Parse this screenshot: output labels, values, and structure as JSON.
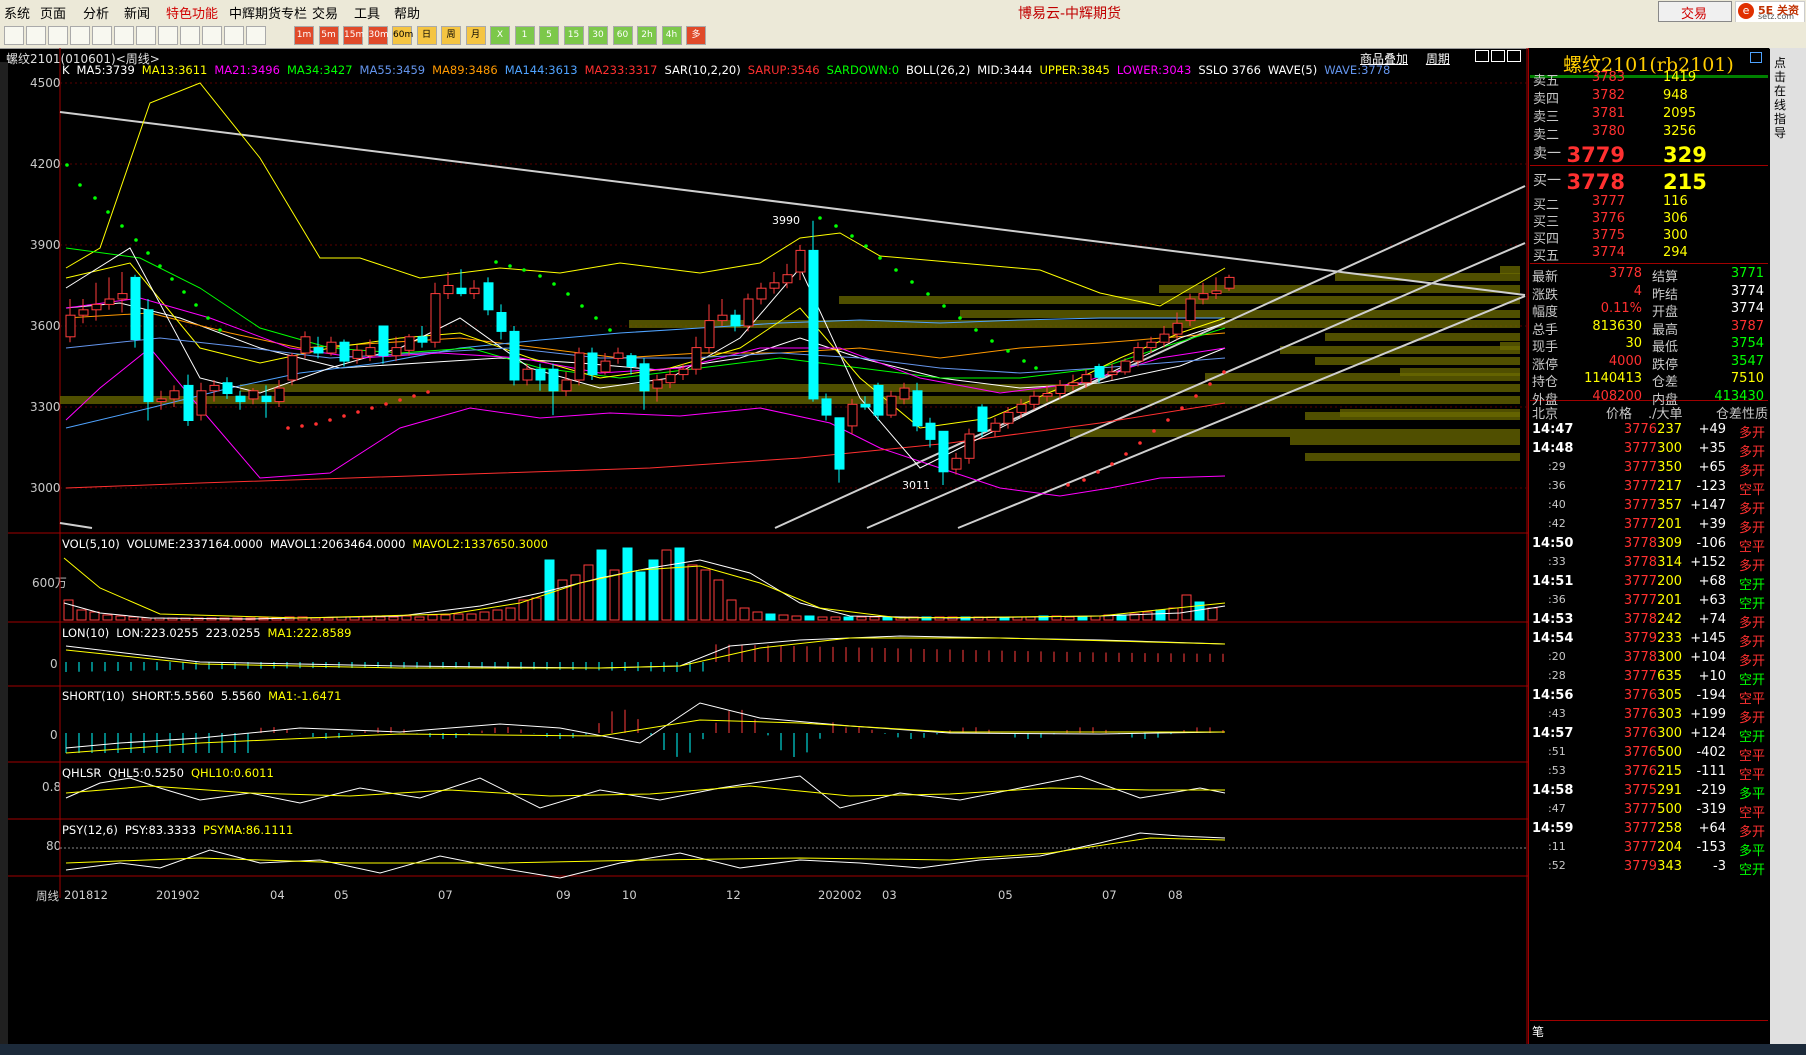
{
  "menu": {
    "items": [
      "系统",
      "页面",
      "分析",
      "新闻",
      "特色功能",
      "中辉期货专栏",
      "交易",
      "工具",
      "帮助"
    ],
    "highlight_index": 4,
    "app_title": "博易云-中辉期货",
    "trade_button": "交易",
    "logo_text": "5E 关资",
    "logo_sub": "setz.com"
  },
  "toolbar": {
    "buttons": [
      "1m",
      "5m",
      "15m",
      "30m",
      "60m",
      "日",
      "周",
      "月",
      "X",
      "1",
      "5",
      "15",
      "30",
      "60",
      "2h",
      "4h",
      "多"
    ]
  },
  "chart": {
    "title": "螺纹2101(010601)<周线>",
    "tabs": [
      "商品叠加",
      "周期"
    ],
    "ma_line": [
      {
        "t": "K",
        "c": "#ffffff"
      },
      {
        "t": "MA5:3739",
        "c": "#ffffff"
      },
      {
        "t": "MA13:3611",
        "c": "#ffff00"
      },
      {
        "t": "MA21:3496",
        "c": "#ff00ff"
      },
      {
        "t": "MA34:3427",
        "c": "#00ff00"
      },
      {
        "t": "MA55:3459",
        "c": "#6495ed"
      },
      {
        "t": "MA89:3486",
        "c": "#ff9900"
      },
      {
        "t": "MA144:3613",
        "c": "#4fa3ff"
      },
      {
        "t": "MA233:3317",
        "c": "#ff3030"
      },
      {
        "t": "SAR(10,2,20)",
        "c": "#ffffff"
      },
      {
        "t": "SARUP:3546",
        "c": "#ff3030"
      },
      {
        "t": "SARDOWN:0",
        "c": "#00ff00"
      },
      {
        "t": "BOLL(26,2)",
        "c": "#ffffff"
      },
      {
        "t": "MID:3444",
        "c": "#ffffff"
      },
      {
        "t": "UPPER:3845",
        "c": "#ffff00"
      },
      {
        "t": "LOWER:3043",
        "c": "#ff00ff"
      },
      {
        "t": "SSLO 3766",
        "c": "#ffffff"
      },
      {
        "t": "WAVE(5)",
        "c": "#ffffff"
      },
      {
        "t": "WAVE:3778",
        "c": "#6495ed"
      }
    ],
    "y_labels": [
      "4500",
      "4200",
      "3900",
      "3600",
      "3300",
      "3000"
    ],
    "y_values": [
      4500,
      4200,
      3900,
      3600,
      3300,
      3000
    ],
    "hi_label": "3990",
    "lo_label": "3011",
    "x_labels": [
      "周线",
      "201812",
      "201902",
      "04",
      "05",
      "07",
      "09",
      "10",
      "12",
      "202002",
      "03",
      "05",
      "07",
      "08"
    ],
    "vol_line": [
      {
        "t": "VOL(5,10)",
        "c": "#ffffff"
      },
      {
        "t": "VOLUME:2337164.0000",
        "c": "#ffffff"
      },
      {
        "t": "MAVOL1:2063464.0000",
        "c": "#ffffff"
      },
      {
        "t": "MAVOL2:1337650.3000",
        "c": "#ffff00"
      }
    ],
    "vol_label": "600万",
    "lon_line": [
      {
        "t": "LON(10)",
        "c": "#ffffff"
      },
      {
        "t": "LON:223.0255",
        "c": "#ffffff"
      },
      {
        "t": "223.0255",
        "c": "#ffffff"
      },
      {
        "t": "MA1:222.8589",
        "c": "#ffff00"
      }
    ],
    "lon_label": "0",
    "short_line": [
      {
        "t": "SHORT(10)",
        "c": "#ffffff"
      },
      {
        "t": "SHORT:5.5560",
        "c": "#ffffff"
      },
      {
        "t": "5.5560",
        "c": "#ffffff"
      },
      {
        "t": "MA1:-1.6471",
        "c": "#ffff00"
      }
    ],
    "short_label": "0",
    "qhl_line": [
      {
        "t": "QHLSR",
        "c": "#ffffff"
      },
      {
        "t": "QHL5:0.5250",
        "c": "#ffffff"
      },
      {
        "t": "QHL10:0.6011",
        "c": "#ffff00"
      }
    ],
    "qhl_label": "0.8",
    "psy_line": [
      {
        "t": "PSY(12,6)",
        "c": "#ffffff"
      },
      {
        "t": "PSY:83.3333",
        "c": "#ffffff"
      },
      {
        "t": "PSYMA:86.1111",
        "c": "#ffff00"
      }
    ],
    "psy_label": "80"
  },
  "panel": {
    "title": "螺纹2101(rb2101)",
    "asks": [
      {
        "l": "卖五",
        "p": "3783",
        "v": "1419"
      },
      {
        "l": "卖四",
        "p": "3782",
        "v": "948"
      },
      {
        "l": "卖三",
        "p": "3781",
        "v": "2095"
      },
      {
        "l": "卖二",
        "p": "3780",
        "v": "3256"
      },
      {
        "l": "卖一",
        "p": "3779",
        "v": "329"
      }
    ],
    "bids": [
      {
        "l": "买一",
        "p": "3778",
        "v": "215"
      },
      {
        "l": "买二",
        "p": "3777",
        "v": "116"
      },
      {
        "l": "买三",
        "p": "3776",
        "v": "306"
      },
      {
        "l": "买四",
        "p": "3775",
        "v": "300"
      },
      {
        "l": "买五",
        "p": "3774",
        "v": "294"
      }
    ],
    "quotes": [
      {
        "k1": "最新",
        "v1": "3778",
        "c1": "#ff3030",
        "k2": "结算",
        "v2": "3771",
        "c2": "#00ff00"
      },
      {
        "k1": "涨跌",
        "v1": "4",
        "c1": "#ff3030",
        "k2": "昨结",
        "v2": "3774",
        "c2": "#ffffff"
      },
      {
        "k1": "幅度",
        "v1": "0.11%",
        "c1": "#ff3030",
        "k2": "开盘",
        "v2": "3774",
        "c2": "#ffffff"
      },
      {
        "k1": "总手",
        "v1": "813630",
        "c1": "#ffff00",
        "k2": "最高",
        "v2": "3787",
        "c2": "#ff3030"
      },
      {
        "k1": "现手",
        "v1": "30",
        "c1": "#ffff00",
        "k2": "最低",
        "v2": "3754",
        "c2": "#00ff00"
      },
      {
        "k1": "涨停",
        "v1": "4000",
        "c1": "#ff3030",
        "k2": "跌停",
        "v2": "3547",
        "c2": "#00ff00"
      },
      {
        "k1": "持仓",
        "v1": "1140413",
        "c1": "#ffff00",
        "k2": "仓差",
        "v2": "7510",
        "c2": "#ffff00"
      },
      {
        "k1": "外盘",
        "v1": "408200",
        "c1": "#ff3030",
        "k2": "内盘",
        "v2": "413430",
        "c2": "#00ff00"
      }
    ],
    "ts_headers": [
      "北京",
      "价格",
      "./大单",
      "仓差",
      "性质"
    ],
    "ticks": [
      {
        "t": "14:47",
        "s": false,
        "p": "3776",
        "q": "237",
        "d": "+49",
        "n": "多开",
        "nc": "#ff3030"
      },
      {
        "t": "14:48",
        "s": false,
        "p": "3777",
        "q": "300",
        "d": "+35",
        "n": "多开",
        "nc": "#ff3030"
      },
      {
        "t": ":29",
        "s": true,
        "p": "3777",
        "q": "350",
        "d": "+65",
        "n": "多开",
        "nc": "#ff3030"
      },
      {
        "t": ":36",
        "s": true,
        "p": "3777",
        "q": "217",
        "d": "-123",
        "n": "空平",
        "nc": "#ff3030"
      },
      {
        "t": ":40",
        "s": true,
        "p": "3777",
        "q": "357",
        "d": "+147",
        "n": "多开",
        "nc": "#ff3030"
      },
      {
        "t": ":42",
        "s": true,
        "p": "3777",
        "q": "201",
        "d": "+39",
        "n": "多开",
        "nc": "#ff3030"
      },
      {
        "t": "14:50",
        "s": false,
        "p": "3778",
        "q": "309",
        "d": "-106",
        "n": "空平",
        "nc": "#ff3030"
      },
      {
        "t": ":33",
        "s": true,
        "p": "3778",
        "q": "314",
        "d": "+152",
        "n": "多开",
        "nc": "#ff3030"
      },
      {
        "t": "14:51",
        "s": false,
        "p": "3777",
        "q": "200",
        "d": "+68",
        "n": "空开",
        "nc": "#00ff00"
      },
      {
        "t": ":36",
        "s": true,
        "p": "3777",
        "q": "201",
        "d": "+63",
        "n": "空开",
        "nc": "#00ff00"
      },
      {
        "t": "14:53",
        "s": false,
        "p": "3778",
        "q": "242",
        "d": "+74",
        "n": "多开",
        "nc": "#ff3030"
      },
      {
        "t": "14:54",
        "s": false,
        "p": "3779",
        "q": "233",
        "d": "+145",
        "n": "多开",
        "nc": "#ff3030"
      },
      {
        "t": ":20",
        "s": true,
        "p": "3778",
        "q": "300",
        "d": "+104",
        "n": "多开",
        "nc": "#ff3030"
      },
      {
        "t": ":28",
        "s": true,
        "p": "3777",
        "q": "635",
        "d": "+10",
        "n": "空开",
        "nc": "#00ff00"
      },
      {
        "t": "14:56",
        "s": false,
        "p": "3776",
        "q": "305",
        "d": "-194",
        "n": "空平",
        "nc": "#ff3030"
      },
      {
        "t": ":43",
        "s": true,
        "p": "3776",
        "q": "303",
        "d": "+199",
        "n": "多开",
        "nc": "#ff3030"
      },
      {
        "t": "14:57",
        "s": false,
        "p": "3776",
        "q": "300",
        "d": "+124",
        "n": "空开",
        "nc": "#00ff00"
      },
      {
        "t": ":51",
        "s": true,
        "p": "3776",
        "q": "500",
        "d": "-402",
        "n": "空平",
        "nc": "#ff3030"
      },
      {
        "t": ":53",
        "s": true,
        "p": "3776",
        "q": "215",
        "d": "-111",
        "n": "空平",
        "nc": "#ff3030"
      },
      {
        "t": "14:58",
        "s": false,
        "p": "3775",
        "q": "291",
        "d": "-219",
        "n": "多平",
        "nc": "#00ff00"
      },
      {
        "t": ":47",
        "s": true,
        "p": "3777",
        "q": "500",
        "d": "-319",
        "n": "空平",
        "nc": "#ff3030"
      },
      {
        "t": "14:59",
        "s": false,
        "p": "3777",
        "q": "258",
        "d": "+64",
        "n": "多开",
        "nc": "#ff3030"
      },
      {
        "t": ":11",
        "s": true,
        "p": "3777",
        "q": "204",
        "d": "-153",
        "n": "多平",
        "nc": "#00ff00"
      },
      {
        "t": ":52",
        "s": true,
        "p": "3779",
        "q": "343",
        "d": "-3",
        "n": "空开",
        "nc": "#00ff00"
      }
    ],
    "bottom_label": "笔",
    "side_ad": "点击在线指导"
  }
}
